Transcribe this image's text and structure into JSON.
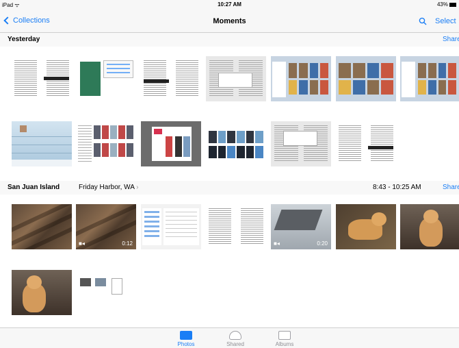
{
  "status": {
    "device": "iPad",
    "time": "10:27 AM",
    "battery": "43%"
  },
  "nav": {
    "back_label": "Collections",
    "title": "Moments",
    "select_label": "Select"
  },
  "sections": [
    {
      "title": "Yesterday",
      "share": "Share"
    },
    {
      "title": "San Juan Island",
      "location": "Friday Harbor, WA",
      "time_range": "8:43 - 10:25 AM",
      "share": "Share"
    }
  ],
  "videos": {
    "duration_1": "0:12",
    "duration_2": "0:20"
  },
  "tabs": [
    {
      "label": "Photos",
      "icon": "photos-icon",
      "active": true
    },
    {
      "label": "Shared",
      "icon": "cloud-icon",
      "active": false
    },
    {
      "label": "Albums",
      "icon": "albums-icon",
      "active": false
    }
  ],
  "colors": {
    "accent": "#1a7ef5",
    "inactive": "#8e8e93"
  }
}
